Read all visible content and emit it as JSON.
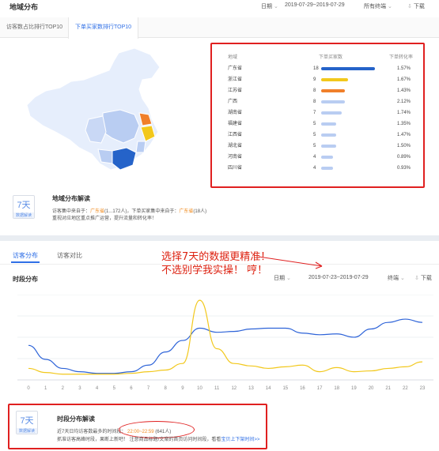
{
  "top": {
    "title": "地域分布",
    "date_label": "日期",
    "date_range": "2019-07-29~2019-07-29",
    "terminal": "所有终端",
    "download": "下载",
    "tabs": [
      "访客数占比排行TOP10",
      "下单买家数排行TOP10"
    ],
    "table": {
      "headers": [
        "地域",
        "下单买家数",
        "下单转化率"
      ],
      "rows": [
        {
          "region": "广东省",
          "count": "18",
          "rate": "1.57%",
          "value": 18,
          "color": "#2563c9"
        },
        {
          "region": "浙江省",
          "count": "9",
          "rate": "1.67%",
          "value": 9,
          "color": "#f2c81c"
        },
        {
          "region": "江苏省",
          "count": "8",
          "rate": "1.43%",
          "value": 8,
          "color": "#f07f2a"
        },
        {
          "region": "广西",
          "count": "8",
          "rate": "2.12%",
          "value": 8,
          "color": "#b9cdf2"
        },
        {
          "region": "湖南省",
          "count": "7",
          "rate": "1.74%",
          "value": 7,
          "color": "#b9cdf2"
        },
        {
          "region": "福建省",
          "count": "5",
          "rate": "1.35%",
          "value": 5,
          "color": "#b9cdf2"
        },
        {
          "region": "江西省",
          "count": "5",
          "rate": "1.47%",
          "value": 5,
          "color": "#b9cdf2"
        },
        {
          "region": "湖北省",
          "count": "5",
          "rate": "1.50%",
          "value": 5,
          "color": "#b9cdf2"
        },
        {
          "region": "河南省",
          "count": "4",
          "rate": "0.89%",
          "value": 4,
          "color": "#b9cdf2"
        },
        {
          "region": "四川省",
          "count": "4",
          "rate": "0.93%",
          "value": 4,
          "color": "#b9cdf2"
        }
      ]
    },
    "interpret": {
      "icon_num": "7天",
      "icon_sub": "数据解读",
      "title": "地域分布解读",
      "line1_a": "访客集中来自于：",
      "line1_b": "广东省",
      "line1_c": "(1...172人)，下单买家集中来自于：",
      "line1_d": "广东省",
      "line1_e": "(18人)",
      "line2": "重视对应地区重点推广运营，提升流量和转化率！"
    }
  },
  "bottom": {
    "tabs": [
      "访客分布",
      "访客对比"
    ],
    "section_title": "时段分布",
    "date_label": "日期",
    "date_range": "2019-07-23~2019-07-29",
    "terminal": "终端",
    "download": "下载",
    "annotation_line1": "选择7天的数据更精准！",
    "annotation_line2": "不选别学我实操！ 哼！",
    "interpret": {
      "icon_num": "7天",
      "icon_sub": "数据解读",
      "title": "时段分布解读",
      "line1_a": "近7天日均访客数最多的时间段：",
      "line1_b": "22:00~22:59",
      "line1_c": "(641人)",
      "line2_a": "抓准访客高峰时段，果断上新吧！ 注意商品标题/文案的首页访问时间段，看看",
      "line2_b": "宝贝上下架时间>>"
    }
  },
  "chart_data": {
    "type": "line",
    "x": [
      0,
      1,
      2,
      3,
      4,
      5,
      6,
      7,
      8,
      9,
      10,
      11,
      12,
      13,
      14,
      15,
      16,
      17,
      18,
      19,
      20,
      21,
      22,
      23
    ],
    "ylim": [
      0,
      100
    ],
    "grid": true,
    "series": [
      {
        "color": "#2d63d8",
        "values": [
          42,
          25,
          14,
          10,
          8,
          8,
          10,
          18,
          34,
          48,
          63,
          58,
          59,
          62,
          63,
          63,
          57,
          55,
          56,
          52,
          62,
          70,
          74,
          70
        ]
      },
      {
        "color": "#f2c81c",
        "values": [
          14,
          9,
          7,
          7,
          7,
          7,
          8,
          10,
          12,
          20,
          97,
          38,
          20,
          17,
          14,
          16,
          18,
          10,
          15,
          10,
          11,
          14,
          16,
          22
        ]
      }
    ]
  }
}
